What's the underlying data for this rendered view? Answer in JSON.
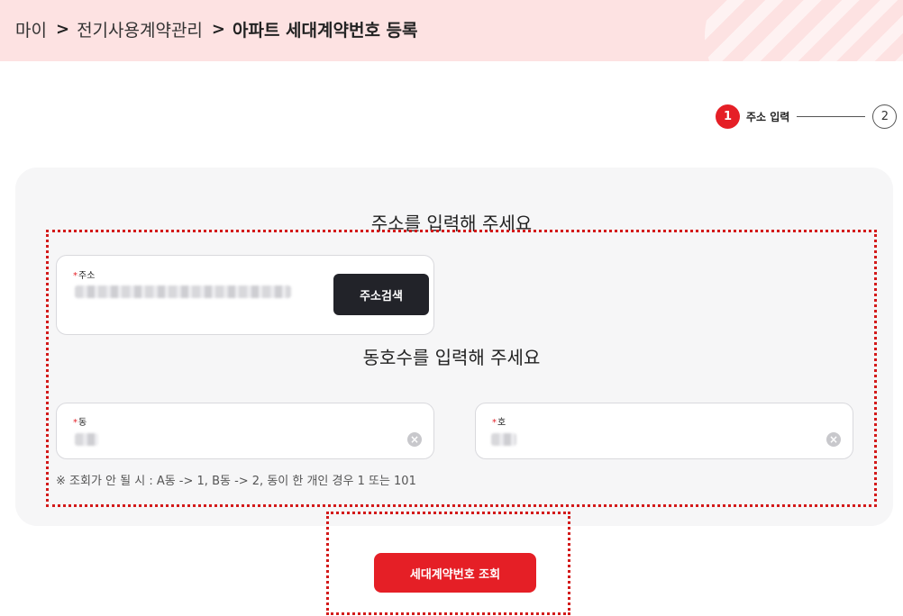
{
  "breadcrumb": {
    "item1": "마이",
    "item2": "전기사용계약관리",
    "current": "아파트 세대계약번호 등록",
    "separator": ">"
  },
  "stepper": {
    "step1_number": "1",
    "step1_label": "주소 입력",
    "step2_number": "2"
  },
  "address_section": {
    "title": "주소를 입력해 주세요",
    "address_label": "주소",
    "required_mark": "*",
    "search_button": "주소검색"
  },
  "unit_section": {
    "title": "동호수를 입력해 주세요",
    "dong_label": "동",
    "ho_label": "호",
    "required_mark": "*",
    "clear_glyph": "×"
  },
  "note": "※ 조회가 안 될 시 : A동 -> 1, B동 -> 2, 동이 한 개인 경우 1 또는 101",
  "submit_button": "세대계약번호 조회",
  "colors": {
    "accent": "#e51f26",
    "header_bg": "#fde2e2",
    "panel_bg": "#f6f6f7",
    "dark_button": "#222329"
  }
}
